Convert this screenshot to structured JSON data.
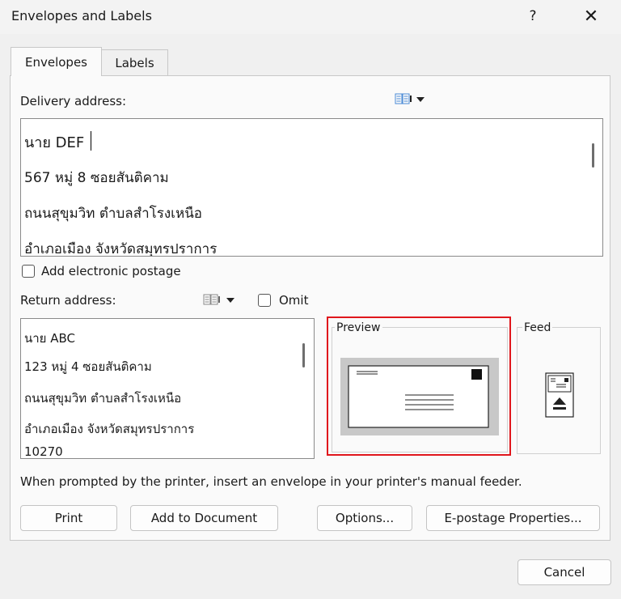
{
  "window": {
    "title": "Envelopes and Labels",
    "help": "?",
    "close": "✕"
  },
  "tabs": [
    {
      "label": "Envelopes"
    },
    {
      "label": "Labels"
    }
  ],
  "delivery": {
    "label": "Delivery address:",
    "lines": [
      "นาย DEF",
      "567 หมู่ 8 ซอยสันติคาม",
      "ถนนสุขุมวิท ตำบลสำโรงเหนือ",
      "อำเภอเมือง จังหวัดสมุทรปราการ"
    ]
  },
  "postage": {
    "label": "Add electronic postage"
  },
  "return": {
    "label": "Return address:",
    "omit": "Omit",
    "lines": [
      "นาย ABC",
      "123 หมู่ 4 ซอยสันติคาม",
      "ถนนสุขุมวิท ตำบลสำโรงเหนือ",
      "อำเภอเมือง จังหวัดสมุทรปราการ",
      "10270"
    ]
  },
  "preview": {
    "label": "Preview"
  },
  "feed": {
    "label": "Feed"
  },
  "info": "When prompted by the printer, insert an envelope in your printer's manual feeder.",
  "buttons": {
    "print": "Print",
    "add": "Add to Document",
    "options": "Options...",
    "epostage": "E-postage Properties...",
    "cancel": "Cancel"
  },
  "highlight_color": "#e0161c"
}
